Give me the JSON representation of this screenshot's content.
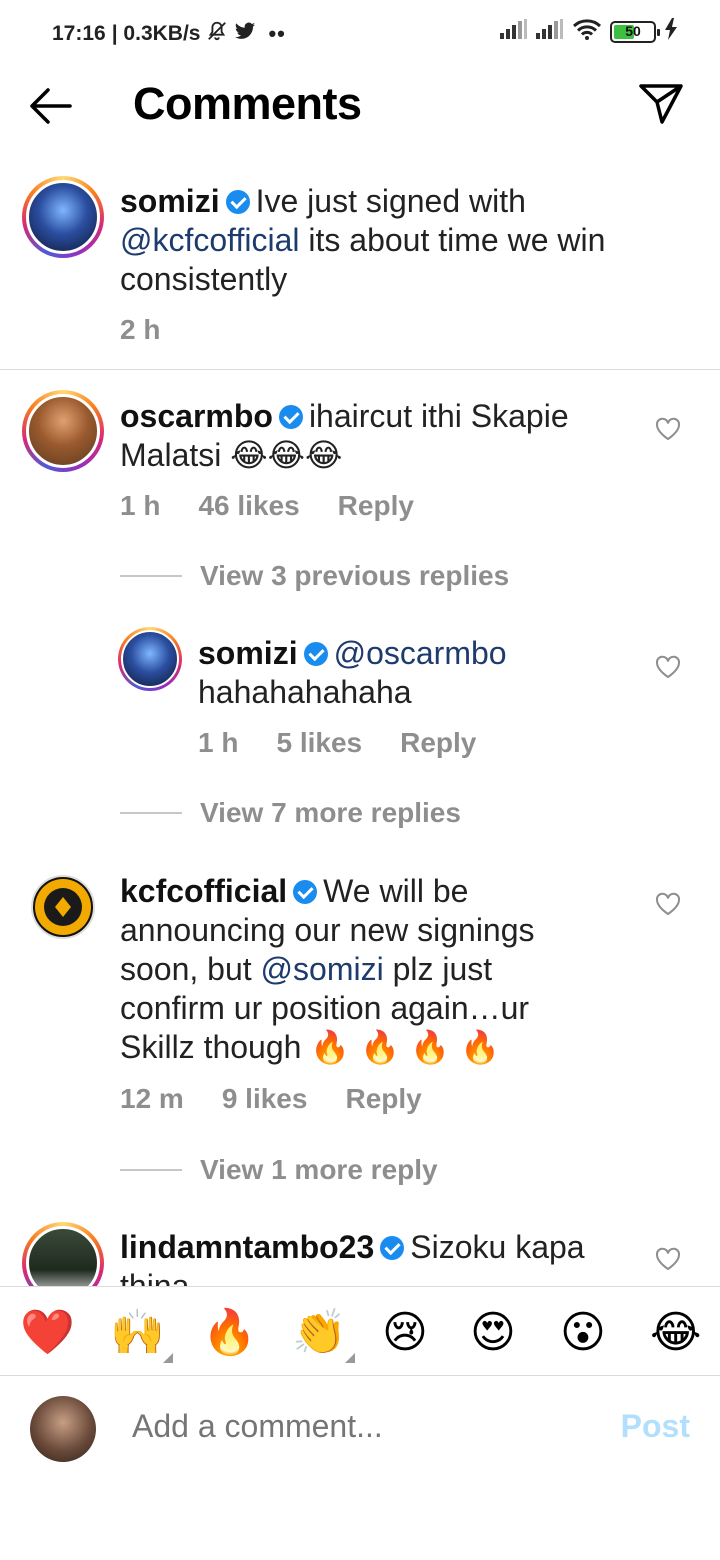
{
  "status_bar": {
    "time": "17:16",
    "net_speed": "| 0.3KB/s",
    "battery": "50",
    "icons": [
      "mute-icon",
      "twitter-icon",
      "more-dots-icon",
      "signal-icon",
      "wifi-icon",
      "battery-icon",
      "charging-icon"
    ]
  },
  "header": {
    "title": "Comments"
  },
  "caption": {
    "username": "somizi",
    "text_pre": "Ive just signed with",
    "mention": "@kcfcofficial",
    "text_post": "its about time we win consistently",
    "time": "2 h"
  },
  "comments": [
    {
      "username": "oscarmbo",
      "text": "ihaircut ithi Skapie Malatsi",
      "emoji": "😂😂😂",
      "time": "1 h",
      "likes": "46 likes",
      "reply": "Reply",
      "view_replies": "View 3 previous replies",
      "replies": [
        {
          "username": "somizi",
          "mention": "@oscarmbo",
          "text": "hahahahahaha",
          "time": "1 h",
          "likes": "5 likes",
          "reply": "Reply"
        }
      ],
      "view_more": "View 7 more replies"
    },
    {
      "username": "kcfcofficial",
      "text_pre": "We will be announcing our new signings soon, but",
      "mention": "@somizi",
      "text_post": "plz just confirm ur position again…ur Skillz though",
      "emoji": "🔥 🔥 🔥 🔥",
      "time": "12 m",
      "likes": "9 likes",
      "reply": "Reply",
      "view_more": "View 1 more reply"
    },
    {
      "username": "lindamntambo23",
      "text": "Sizoku kapa thina"
    }
  ],
  "emoji_bar": [
    "❤️",
    "🙌",
    "🔥",
    "👏",
    "😢",
    "😍",
    "😮",
    "😂"
  ],
  "input": {
    "placeholder": "Add a comment...",
    "post_label": "Post"
  },
  "colors": {
    "accent": "#0095f6",
    "post_disabled": "#b2dffc",
    "verified": "#1a8cf0",
    "mention": "#1e3b6e"
  }
}
